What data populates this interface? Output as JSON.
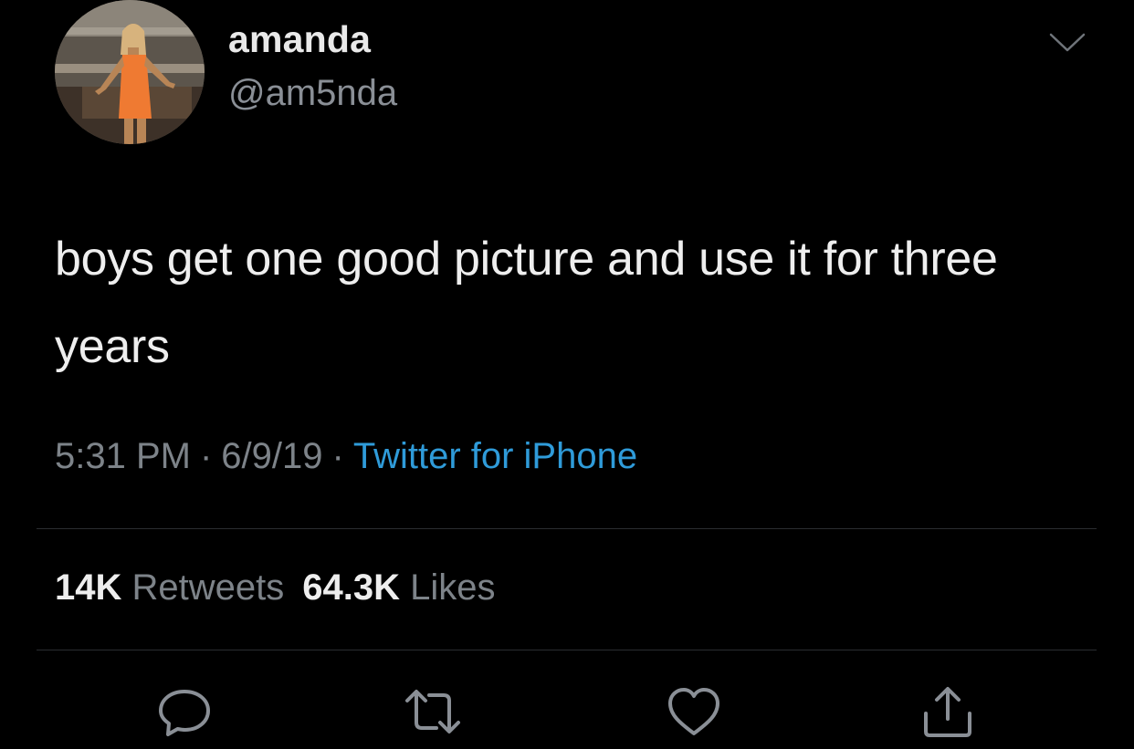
{
  "user": {
    "display_name": "amanda",
    "handle": "@am5nda",
    "avatar_icon": "profile-photo"
  },
  "tweet": {
    "text": "boys get one good picture and use it for three years",
    "time": "5:31 PM",
    "date": "6/9/19",
    "separator": "·",
    "source": "Twitter for iPhone"
  },
  "stats": {
    "retweets_count": "14K",
    "retweets_label": "Retweets",
    "likes_count": "64.3K",
    "likes_label": "Likes"
  },
  "actions": {
    "reply_icon": "reply-icon",
    "retweet_icon": "retweet-icon",
    "like_icon": "heart-icon",
    "share_icon": "share-icon"
  },
  "colors": {
    "background": "#000000",
    "link": "#2f9bd9",
    "secondary_text": "#7d8389",
    "icon": "#8a8f96"
  }
}
